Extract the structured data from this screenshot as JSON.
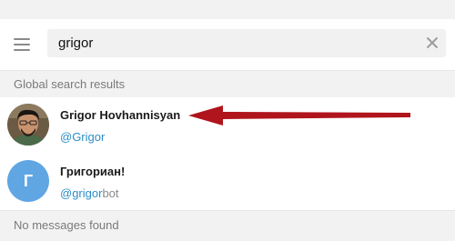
{
  "search": {
    "value": "grigor"
  },
  "sections": {
    "global_results_label": "Global search results",
    "no_messages_label": "No messages found"
  },
  "results": [
    {
      "name": "Grigor Hovhannisyan",
      "handle_match": "@Grigor",
      "handle_rest": "",
      "avatar_type": "photo"
    },
    {
      "name": "Григориан!",
      "handle_match": "@grigor",
      "handle_rest": "bot",
      "avatar_letter": "Г",
      "avatar_color": "#5fa6e3"
    }
  ],
  "annotation": {
    "arrow_color": "#b0141c"
  },
  "colors": {
    "link": "#2b8ec7",
    "section_bg": "#f2f2f2"
  }
}
